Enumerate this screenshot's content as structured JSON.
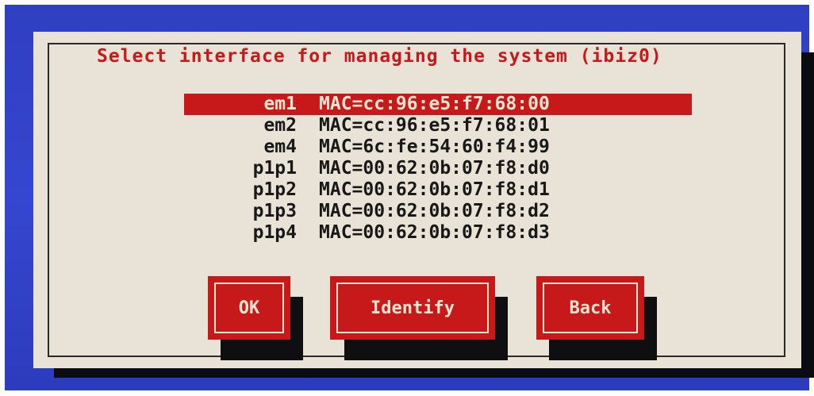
{
  "dialog": {
    "title": "Select interface for managing the system (ibiz0)"
  },
  "interfaces": [
    {
      "name": "em1",
      "mac": "MAC=cc:96:e5:f7:68:00",
      "selected": true
    },
    {
      "name": "em2",
      "mac": "MAC=cc:96:e5:f7:68:01",
      "selected": false
    },
    {
      "name": "em4",
      "mac": "MAC=6c:fe:54:60:f4:99",
      "selected": false
    },
    {
      "name": "p1p1",
      "mac": "MAC=00:62:0b:07:f8:d0",
      "selected": false
    },
    {
      "name": "p1p2",
      "mac": "MAC=00:62:0b:07:f8:d1",
      "selected": false
    },
    {
      "name": "p1p3",
      "mac": "MAC=00:62:0b:07:f8:d2",
      "selected": false
    },
    {
      "name": "p1p4",
      "mac": "MAC=00:62:0b:07:f8:d3",
      "selected": false
    }
  ],
  "buttons": {
    "ok_label": "OK",
    "identify_label": "Identify",
    "back_label": "Back"
  },
  "colors": {
    "screen_background": "#3143c8",
    "dialog_background": "#e8e3d6",
    "accent_red": "#c8191a",
    "text_dark": "#181818",
    "text_light": "#f1e6d2"
  }
}
